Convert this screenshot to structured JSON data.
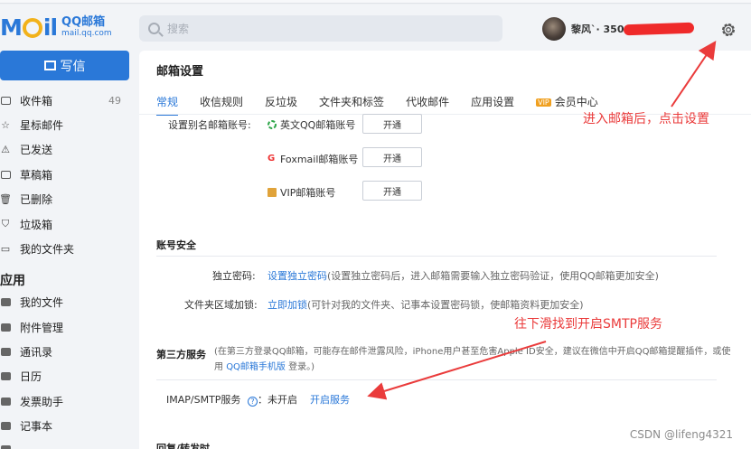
{
  "header": {
    "logo_text": "M  il",
    "logo_brand": "QQ邮箱",
    "logo_domain": "mail.qq.com",
    "search_placeholder": "搜索",
    "username": "黎风`· 3500",
    "accent_color": "#2a78d8",
    "gear_icon": "gear-icon"
  },
  "sidebar": {
    "write_label": "写信",
    "items": [
      {
        "label": "收件箱",
        "count": "49",
        "icon": "inbox-icon"
      },
      {
        "label": "星标邮件",
        "icon": "star-icon"
      },
      {
        "label": "已发送",
        "icon": "send-icon"
      },
      {
        "label": "草稿箱",
        "icon": "draft-icon"
      },
      {
        "label": "已删除",
        "icon": "trash-icon"
      },
      {
        "label": "垃圾箱",
        "icon": "shield-icon"
      },
      {
        "label": "我的文件夹",
        "icon": "folder-icon"
      }
    ],
    "apps_heading": "应用",
    "apps": [
      {
        "label": "我的文件",
        "icon": "file-icon"
      },
      {
        "label": "附件管理",
        "icon": "attachment-icon"
      },
      {
        "label": "通讯录",
        "icon": "contacts-icon"
      },
      {
        "label": "日历",
        "icon": "calendar-icon"
      },
      {
        "label": "发票助手",
        "icon": "invoice-icon"
      },
      {
        "label": "记事本",
        "icon": "notepad-icon"
      },
      {
        "label": "…",
        "icon": "more-icon"
      }
    ]
  },
  "settings": {
    "title": "邮箱设置",
    "tabs": [
      "常规",
      "收信规则",
      "反垃圾",
      "文件夹和标签",
      "代收邮件",
      "应用设置",
      "会员中心"
    ],
    "active_tab": "常规",
    "alias_label": "设置别名邮箱账号:",
    "alias_options": [
      {
        "label": "英文QQ邮箱账号",
        "button": "开通"
      },
      {
        "label": "Foxmail邮箱账号",
        "button": "开通"
      },
      {
        "label": "VIP邮箱账号",
        "button": "开通"
      }
    ],
    "security_title": "账号安全",
    "independent_pw_label": "独立密码:",
    "independent_pw_link": "设置独立密码",
    "independent_pw_desc": "(设置独立密码后，进入邮箱需要输入独立密码验证，使用QQ邮箱更加安全)",
    "folder_lock_label": "文件夹区域加锁:",
    "folder_lock_link": "立即加锁",
    "folder_lock_desc": "(可针对我的文件夹、记事本设置密码锁，使邮箱资料更加安全)",
    "third_party_title": "第三方服务",
    "third_party_desc_1": "(在第三方登录QQ邮箱，可能存在邮件泄露风险，iPhone用户甚至危害Apple ID安全，建议在微信中开启QQ邮箱提醒插件，或使",
    "third_party_desc_2a": "用",
    "third_party_desc_link": "QQ邮箱手机版",
    "third_party_desc_2b": "登录。)",
    "imap_label": "IMAP/SMTP服务",
    "imap_status": "未开启",
    "imap_link": "开启服务",
    "bottom_section": "回复/转发时"
  },
  "annotations": {
    "note_top": "进入邮箱后，点击设置",
    "note_mid": "往下滑找到开启SMTP服务",
    "annotation_color": "#ea3b3b"
  },
  "watermark": "CSDN @lifeng4321"
}
